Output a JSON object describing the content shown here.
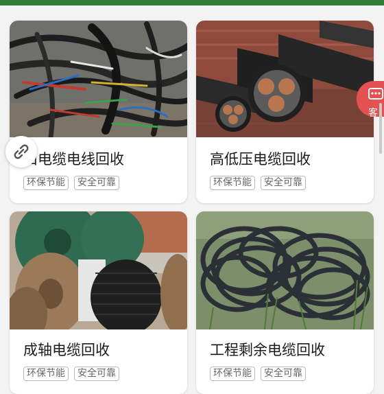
{
  "products": [
    {
      "title": "旧电缆电线回收",
      "tags": [
        "环保节能",
        "安全可靠"
      ],
      "image": "pile-of-old-cables-photo"
    },
    {
      "title": "高低压电缆回收",
      "tags": [
        "环保节能",
        "安全可靠"
      ],
      "image": "high-voltage-cable-cross-section-photo"
    },
    {
      "title": "成轴电缆回收",
      "tags": [
        "环保节能",
        "安全可靠"
      ],
      "image": "cable-reels-photo"
    },
    {
      "title": "工程剩余电缆回收",
      "tags": [
        "环保节能",
        "安全可靠"
      ],
      "image": "coiled-cable-pile-photo"
    }
  ],
  "floating": {
    "link_icon": "link-icon",
    "service_icon": "chat-icon",
    "service_label": "客"
  },
  "colors": {
    "top_bar": "#2e7d32",
    "service_button": "#e45151",
    "tag_border": "#b9b9b9"
  }
}
